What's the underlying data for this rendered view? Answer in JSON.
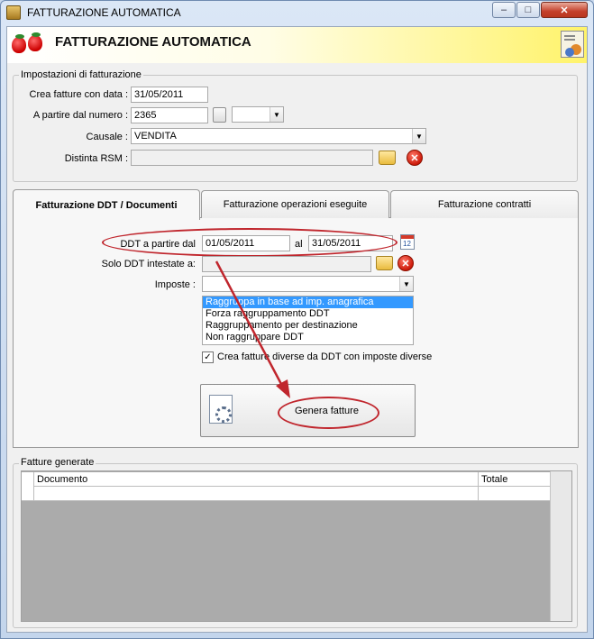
{
  "window": {
    "title": "FATTURAZIONE AUTOMATICA",
    "buttons": {
      "minimize": "–",
      "maximize": "□",
      "close": "✕"
    }
  },
  "header": {
    "title": "FATTURAZIONE AUTOMATICA"
  },
  "settings": {
    "legend": "Impostazioni di fatturazione",
    "date_label": "Crea fatture con data :",
    "date_value": "31/05/2011",
    "number_label": "A partire dal numero :",
    "number_value": "2365",
    "causale_label": "Causale :",
    "causale_value": "VENDITA",
    "distinta_label": "Distinta RSM :",
    "distinta_value": ""
  },
  "tabs": [
    {
      "label": "Fatturazione DDT / Documenti"
    },
    {
      "label": "Fatturazione operazioni eseguite"
    },
    {
      "label": "Fatturazione contratti"
    }
  ],
  "ddt": {
    "from_label": "DDT a partire dal",
    "from_value": "01/05/2011",
    "to_label": "al",
    "to_value": "31/05/2011",
    "solo_label": "Solo DDT intestate a:",
    "solo_value": "",
    "imposte_label": "Imposte :",
    "imposte_value": "",
    "grouping_options": [
      "Raggruppa in base ad imp. anagrafica",
      "Forza raggruppamento DDT",
      "Raggruppamento per destinazione",
      "Non raggruppare DDT"
    ],
    "checkbox_label": "Crea fatture diverse da DDT con imposte diverse",
    "checkbox_mark": "✓",
    "generate_label": "Genera fatture"
  },
  "generated": {
    "legend": "Fatture generate",
    "columns": [
      "Documento",
      "Totale"
    ]
  },
  "calendar_icon_text": "12",
  "colors": {
    "annotation": "#c0262d",
    "selection": "#3399ff",
    "header_yellow": "#fff36a"
  }
}
